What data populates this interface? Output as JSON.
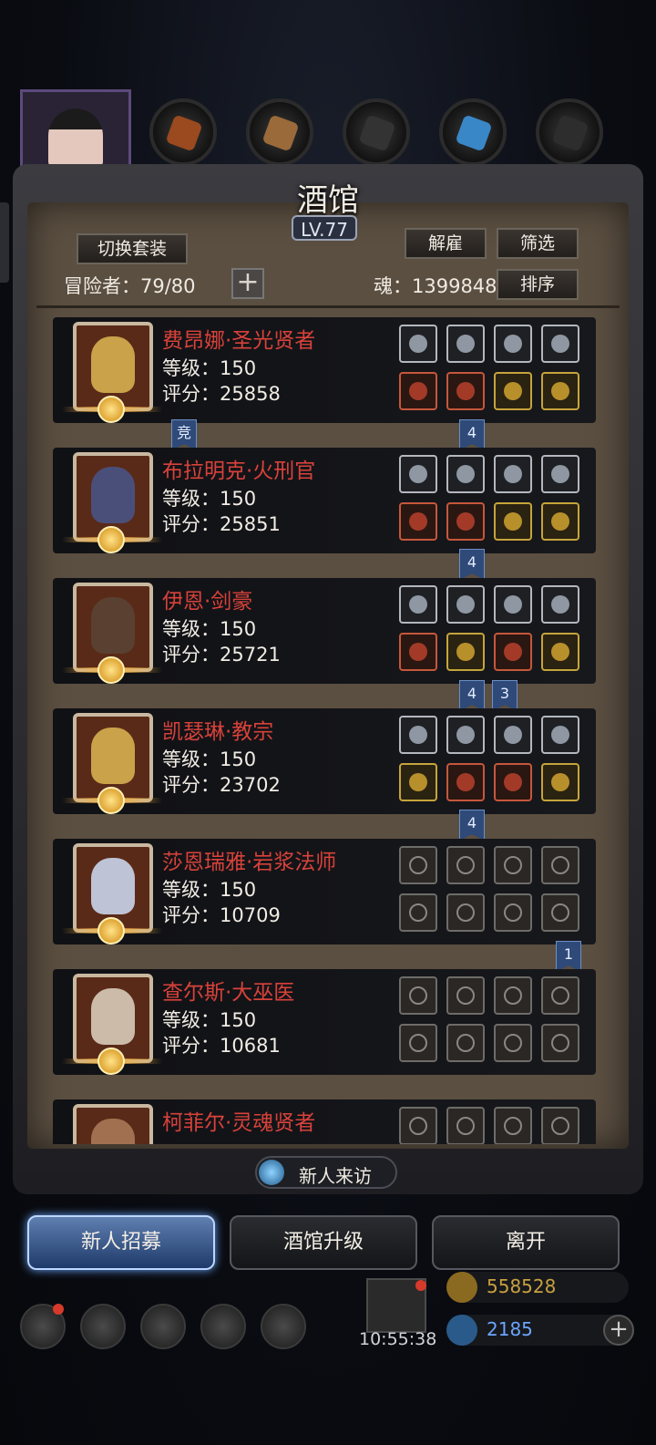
{
  "header": {
    "title": "酒馆",
    "level": "LV.77"
  },
  "toolbar": {
    "switch_outfit": "切换套装",
    "dismiss": "解雇",
    "filter": "筛选",
    "sort": "排序",
    "adventurers": "冒险者：79/80",
    "soul": "魂：1399848"
  },
  "heroes": [
    {
      "name": "费昂娜·圣光贤者",
      "level": "等级：150",
      "score": "评分：25858",
      "portrait_color": "#c9a24a"
    },
    {
      "name": "布拉明克·火刑官",
      "level": "等级：150",
      "score": "评分：25851",
      "portrait_color": "#4a4f7a"
    },
    {
      "name": "伊恩·剑豪",
      "level": "等级：150",
      "score": "评分：25721",
      "portrait_color": "#5a4030"
    },
    {
      "name": "凯瑟琳·教宗",
      "level": "等级：150",
      "score": "评分：23702",
      "portrait_color": "#c9a24a"
    },
    {
      "name": "莎恩瑞雅·岩浆法师",
      "level": "等级：150",
      "score": "评分：10709",
      "portrait_color": "#bfc3d6"
    },
    {
      "name": "查尔斯·大巫医",
      "level": "等级：150",
      "score": "评分：10681",
      "portrait_color": "#cbbba8"
    },
    {
      "name": "柯菲尔·灵魂贤者",
      "level": "",
      "score": "",
      "portrait_color": "#a07050"
    }
  ],
  "tags": {
    "t0": "竞",
    "t1": "4",
    "t2": "4",
    "t3": "4",
    "t4": "3",
    "t5": "4",
    "t6": "1"
  },
  "bottom": {
    "new_visit": "新人来访",
    "recruit": "新人招募",
    "upgrade": "酒馆升级",
    "leave": "离开",
    "timer": "10:55:38",
    "gold": "558528",
    "gems": "2185",
    "gold_color": "#c8a040",
    "gem_color": "#6aa6ff"
  }
}
